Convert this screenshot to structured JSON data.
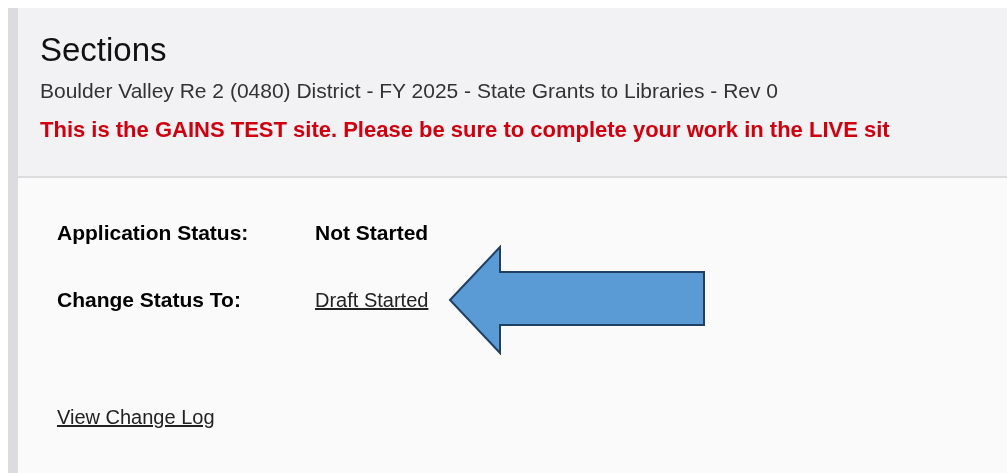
{
  "header": {
    "title": "Sections",
    "subtitle": "Boulder Valley Re 2 (0480) District - FY 2025 - State Grants to Libraries - Rev 0",
    "warning": "This is the GAINS TEST site. Please be sure to complete your work in the LIVE sit"
  },
  "status": [
    {
      "kind": "text",
      "label": "Application Status:",
      "value": "Not Started"
    },
    {
      "kind": "link",
      "label": "Change Status To:",
      "value": "Draft Started"
    }
  ],
  "change_log_link": "View Change Log"
}
